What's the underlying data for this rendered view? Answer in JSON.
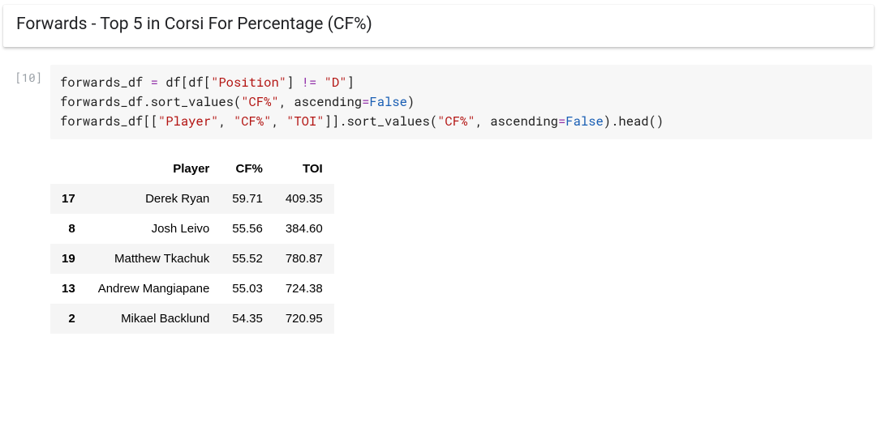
{
  "title": "Forwards - Top 5 in Corsi For Percentage (CF%)",
  "prompt": "[10]",
  "code": {
    "l1a": "forwards_df ",
    "l1b": "=",
    "l1c": " df[df[",
    "l1d": "\"Position\"",
    "l1e": "] ",
    "l1f": "!=",
    "l1g": " ",
    "l1h": "\"D\"",
    "l1i": "]",
    "l2a": "forwards_df.sort_values(",
    "l2b": "\"CF%\"",
    "l2c": ", ascending",
    "l2d": "=",
    "l2e": "False",
    "l2f": ")",
    "l3a": "forwards_df[[",
    "l3b": "\"Player\"",
    "l3c": ", ",
    "l3d": "\"CF%\"",
    "l3e": ", ",
    "l3f": "\"TOI\"",
    "l3g": "]].sort_values(",
    "l3h": "\"CF%\"",
    "l3i": ", ascending",
    "l3j": "=",
    "l3k": "False",
    "l3l": ").head()"
  },
  "table": {
    "columns": [
      "Player",
      "CF%",
      "TOI"
    ],
    "rows": [
      {
        "idx": "17",
        "player": "Derek Ryan",
        "cf": "59.71",
        "toi": "409.35"
      },
      {
        "idx": "8",
        "player": "Josh Leivo",
        "cf": "55.56",
        "toi": "384.60"
      },
      {
        "idx": "19",
        "player": "Matthew Tkachuk",
        "cf": "55.52",
        "toi": "780.87"
      },
      {
        "idx": "13",
        "player": "Andrew Mangiapane",
        "cf": "55.03",
        "toi": "724.38"
      },
      {
        "idx": "2",
        "player": "Mikael Backlund",
        "cf": "54.35",
        "toi": "720.95"
      }
    ]
  }
}
